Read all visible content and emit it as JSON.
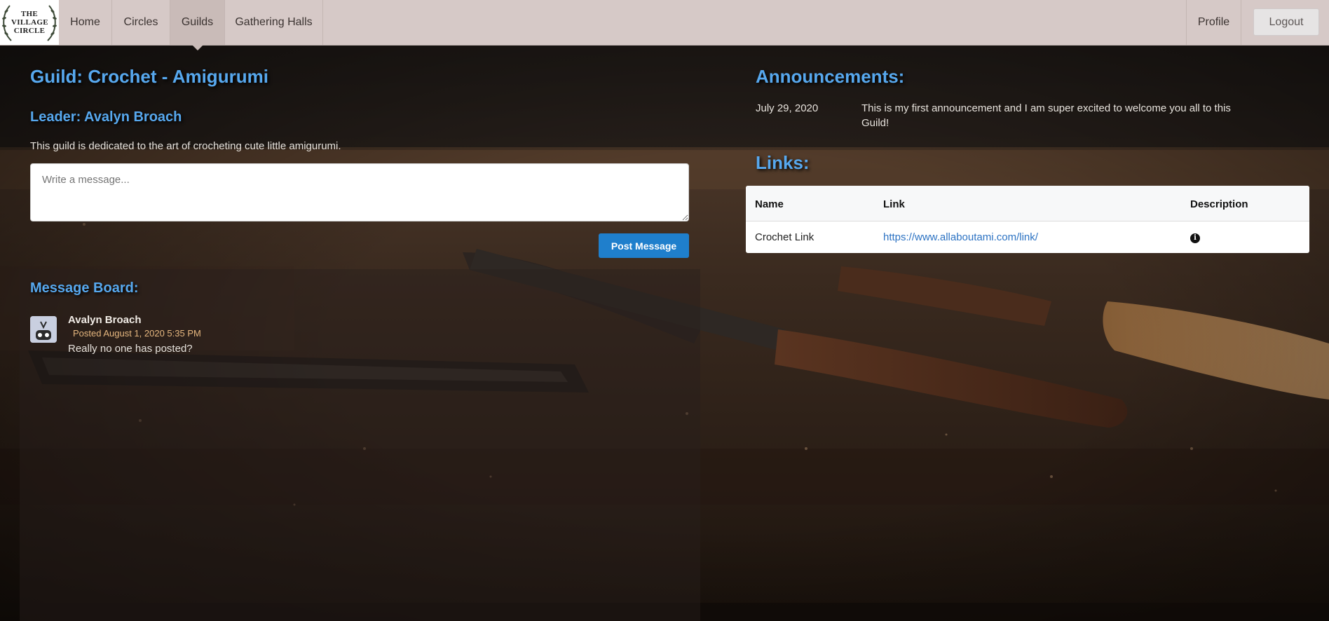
{
  "nav": {
    "logo_text": "THE VILLAGE CIRCLE",
    "items": [
      {
        "label": "Home"
      },
      {
        "label": "Circles"
      },
      {
        "label": "Guilds"
      },
      {
        "label": "Gathering Halls"
      }
    ],
    "active": "Guilds",
    "profile_label": "Profile",
    "logout_label": "Logout"
  },
  "guild": {
    "title": "Guild: Crochet - Amigurumi",
    "leader": "Leader: Avalyn Broach",
    "description": "This guild is dedicated to the art of crocheting cute little amigurumi.",
    "message_placeholder": "Write a message...",
    "post_button": "Post Message"
  },
  "message_board": {
    "heading": "Message Board:",
    "messages": [
      {
        "author": "Avalyn Broach",
        "posted": "Posted August 1, 2020 5:35 PM",
        "text": "Really no one has posted?"
      }
    ]
  },
  "announcements": {
    "heading": "Announcements:",
    "items": [
      {
        "date": "July 29, 2020",
        "text_line1": "This is my first announcement and I am super excited to welcome you all to this",
        "text_line2": "Guild!"
      }
    ]
  },
  "links": {
    "heading": "Links:",
    "columns": [
      "Name",
      "Link",
      "Description"
    ],
    "rows": [
      {
        "name": "Crochet Link",
        "link": "https://www.allaboutami.com/link/",
        "description_icon": "info-circle-icon"
      }
    ]
  },
  "colors": {
    "heading": "#57a8ee",
    "nav_bg": "#d6c9c7",
    "primary_button": "#1f7fcc",
    "link": "#2d73c3",
    "posted_time": "#e6b77f"
  }
}
